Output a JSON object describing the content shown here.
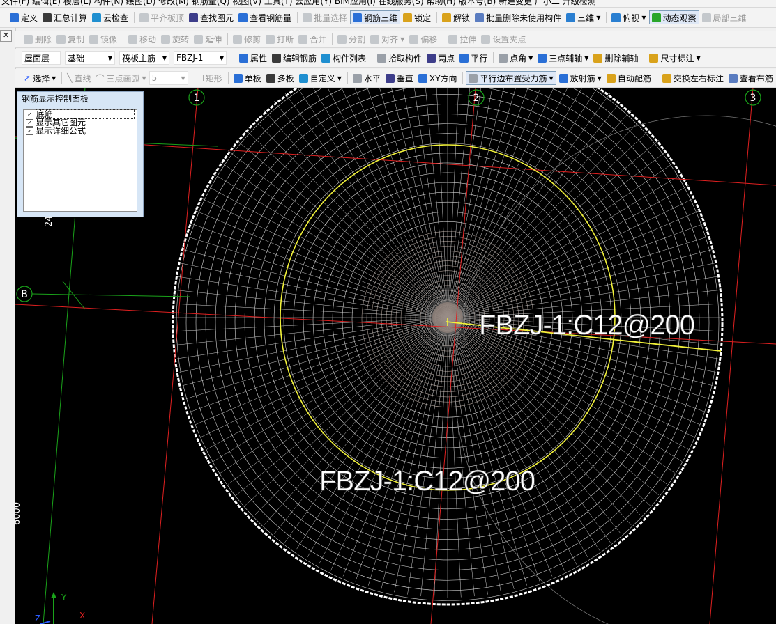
{
  "menu_bar": {
    "text": "文件(F)  编辑(E)  楼层(L)  构件(N)  绘图(D)  修改(M)  钢筋量(Q)  视图(V)  工具(T)  云应用(Y)  BIM应用(I)  在线服务(S)  帮助(H)  版本号(B)  新建变更  广小二  升级检测"
  },
  "toolbar1": [
    {
      "label": "定义",
      "icon": "define-icon"
    },
    {
      "label": "汇总计算",
      "icon": "sigma-icon"
    },
    {
      "label": "云检查",
      "icon": "cloud-check-icon"
    },
    {
      "label": "平齐板顶",
      "icon": "align-top-icon",
      "disabled": true
    },
    {
      "label": "查找图元",
      "icon": "binoculars-icon"
    },
    {
      "label": "查看钢筋量",
      "icon": "view-rebar-icon"
    },
    {
      "label": "批量选择",
      "icon": "batch-select-icon",
      "disabled": true
    },
    {
      "label": "钢筋三维",
      "icon": "rebar-3d-icon",
      "active": true
    },
    {
      "label": "锁定",
      "icon": "lock-icon"
    },
    {
      "label": "解锁",
      "icon": "unlock-icon"
    },
    {
      "label": "批量删除未使用构件",
      "icon": "batch-delete-icon"
    },
    {
      "label": "三维",
      "icon": "cube-icon",
      "dropdown": true
    },
    {
      "label": "俯视",
      "icon": "top-view-icon",
      "dropdown": true
    },
    {
      "label": "动态观察",
      "icon": "orbit-icon",
      "active": true
    },
    {
      "label": "局部三维",
      "icon": "local-3d-icon",
      "disabled": true
    }
  ],
  "toolbar2": [
    {
      "label": "删除",
      "icon": "delete-icon",
      "disabled": true
    },
    {
      "label": "复制",
      "icon": "copy-icon",
      "disabled": true
    },
    {
      "label": "镜像",
      "icon": "mirror-icon",
      "disabled": true
    },
    {
      "label": "移动",
      "icon": "move-icon",
      "disabled": true
    },
    {
      "label": "旋转",
      "icon": "rotate-icon",
      "disabled": true
    },
    {
      "label": "延伸",
      "icon": "extend-icon",
      "disabled": true
    },
    {
      "label": "修剪",
      "icon": "trim-icon",
      "disabled": true
    },
    {
      "label": "打断",
      "icon": "break-icon",
      "disabled": true
    },
    {
      "label": "合并",
      "icon": "merge-icon",
      "disabled": true
    },
    {
      "label": "分割",
      "icon": "split-icon",
      "disabled": true
    },
    {
      "label": "对齐",
      "icon": "align-icon",
      "disabled": true,
      "dropdown": true
    },
    {
      "label": "偏移",
      "icon": "offset-icon",
      "disabled": true
    },
    {
      "label": "拉伸",
      "icon": "stretch-icon",
      "disabled": true
    },
    {
      "label": "设置夹点",
      "icon": "grip-point-icon",
      "disabled": true
    }
  ],
  "toolbar3": {
    "floor": "屋面层",
    "category": "基础",
    "type": "筏板主筋",
    "component": "FBZJ-1",
    "items": [
      {
        "label": "属性",
        "icon": "property-icon"
      },
      {
        "label": "编辑钢筋",
        "icon": "edit-rebar-icon"
      },
      {
        "label": "构件列表",
        "icon": "component-list-icon"
      },
      {
        "label": "拾取构件",
        "icon": "pick-icon"
      },
      {
        "label": "两点",
        "icon": "two-point-icon"
      },
      {
        "label": "平行",
        "icon": "parallel-icon"
      },
      {
        "label": "点角",
        "icon": "point-angle-icon",
        "dropdown": true
      },
      {
        "label": "三点辅轴",
        "icon": "three-point-axis-icon",
        "dropdown": true
      },
      {
        "label": "删除辅轴",
        "icon": "delete-axis-icon"
      },
      {
        "label": "尺寸标注",
        "icon": "dimension-icon",
        "dropdown": true
      }
    ]
  },
  "toolbar4": {
    "select": "选择",
    "line": "直线",
    "arc": "三点画弧",
    "arc_value": "5",
    "rect": "矩形",
    "items": [
      {
        "label": "单板",
        "icon": "single-slab-icon"
      },
      {
        "label": "多板",
        "icon": "multi-slab-icon"
      },
      {
        "label": "自定义",
        "icon": "custom-icon",
        "dropdown": true
      },
      {
        "label": "水平",
        "icon": "horizontal-icon"
      },
      {
        "label": "垂直",
        "icon": "vertical-icon"
      },
      {
        "label": "XY方向",
        "icon": "xy-direction-icon"
      },
      {
        "label": "平行边布置受力筋",
        "icon": "parallel-edge-icon",
        "active": true,
        "dropdown": true
      },
      {
        "label": "放射筋",
        "icon": "radial-rebar-icon",
        "dropdown": true
      },
      {
        "label": "自动配筋",
        "icon": "auto-rebar-icon"
      },
      {
        "label": "交换左右标注",
        "icon": "swap-label-icon"
      },
      {
        "label": "查看布筋",
        "icon": "view-layout-icon"
      }
    ]
  },
  "panel": {
    "title": "钢筋显示控制面板",
    "options": [
      {
        "label": "底筋",
        "checked": true,
        "selected": true
      },
      {
        "label": "显示其它图元",
        "checked": true
      },
      {
        "label": "显示详细公式",
        "checked": true
      }
    ]
  },
  "canvas": {
    "axis_labels": [
      "1",
      "2",
      "3",
      "B"
    ],
    "rebar_label_1": "FBZJ-1:C12@200",
    "rebar_label_2": "FBZJ-1:C12@200",
    "dim_left_1": "24",
    "dim_left_2": "6000",
    "ucs_y": "Y",
    "ucs_x": "X",
    "ucs_z": "Z"
  },
  "colors": {
    "canvas_bg": "#000000",
    "mesh": "#d8d8d8",
    "yellow_rebar": "#f2f23a",
    "axis_red": "#e02020",
    "axis_green": "#1aa31a",
    "ucs_blue": "#2a5cff"
  }
}
